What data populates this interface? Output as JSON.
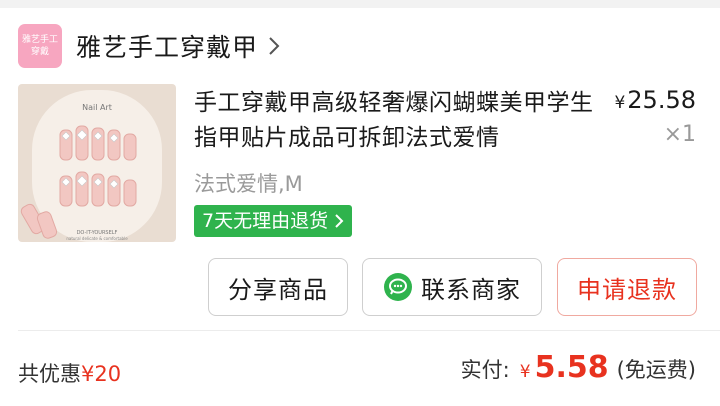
{
  "shop": {
    "logo_line1": "雅艺手工",
    "logo_line2": "穿戴",
    "name": "雅艺手工穿戴甲"
  },
  "product": {
    "title": "手工穿戴甲高级轻奢爆闪蝴蝶美甲学生指甲贴片成品可拆卸法式爱情",
    "price_symbol": "¥",
    "price": "25.58",
    "quantity": "×1",
    "variant": "法式爱情,M",
    "badge": "7天无理由退货",
    "image_texts": {
      "top": "Nail Art",
      "bottom1": "DO-IT-YOURSELF",
      "bottom2": "natural delicate & comfortable"
    }
  },
  "actions": {
    "share": "分享商品",
    "contact": "联系商家",
    "refund": "申请退款"
  },
  "summary": {
    "discount_label": "共优惠",
    "discount_amount": "¥20",
    "paid_label": "实付:",
    "paid_symbol": "¥",
    "paid_amount": "5.58",
    "shipping_note": "(免运费)"
  },
  "colors": {
    "accent_red": "#e8321f",
    "badge_green": "#2fb34d",
    "logo_pink": "#f7a6c0"
  }
}
